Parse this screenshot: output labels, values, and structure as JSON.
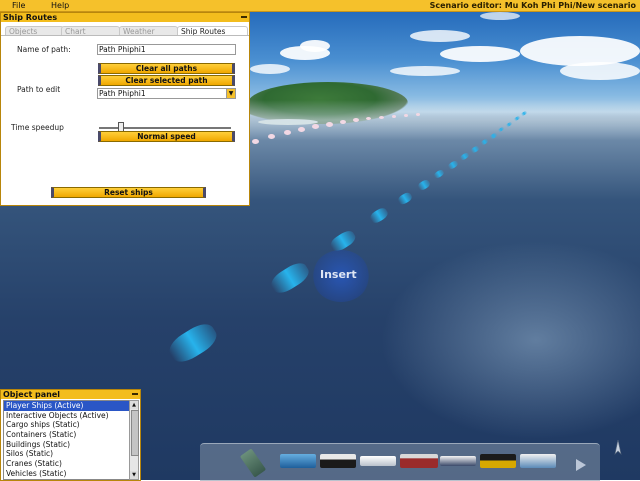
{
  "menubar": {
    "file_label": "File",
    "help_label": "Help",
    "title": "Scenario editor: Mu Koh Phi Phi/New scenario"
  },
  "ship_routes_panel": {
    "title": "Ship Routes",
    "tabs": [
      {
        "label": "Objects",
        "active": false
      },
      {
        "label": "Chart",
        "active": false
      },
      {
        "label": "Weather",
        "active": false
      },
      {
        "label": "Ship Routes",
        "active": true
      }
    ],
    "name_of_path_label": "Name of path:",
    "name_of_path_value": "Path Phiphi1",
    "clear_all_paths_label": "Clear all paths",
    "clear_selected_path_label": "Clear selected path",
    "path_to_edit_label": "Path to edit",
    "path_to_edit_value": "Path Phiphi1",
    "time_speedup_label": "Time speedup",
    "normal_speed_label": "Normal speed",
    "reset_ships_label": "Reset ships"
  },
  "scene": {
    "insert_label": "Insert"
  },
  "object_panel": {
    "title": "Object panel",
    "items": [
      {
        "label": "Player Ships (Active)",
        "selected": true
      },
      {
        "label": "Interactive Objects (Active)",
        "selected": false
      },
      {
        "label": "Cargo ships (Static)",
        "selected": false
      },
      {
        "label": "Containers (Static)",
        "selected": false
      },
      {
        "label": "Buildings (Static)",
        "selected": false
      },
      {
        "label": "Silos (Static)",
        "selected": false
      },
      {
        "label": "Cranes (Static)",
        "selected": false
      },
      {
        "label": "Vehicles (Static)",
        "selected": false
      }
    ]
  },
  "colors": {
    "accent": "#f3bd1d",
    "selection": "#2a56c6",
    "route": "#27b3ec"
  }
}
